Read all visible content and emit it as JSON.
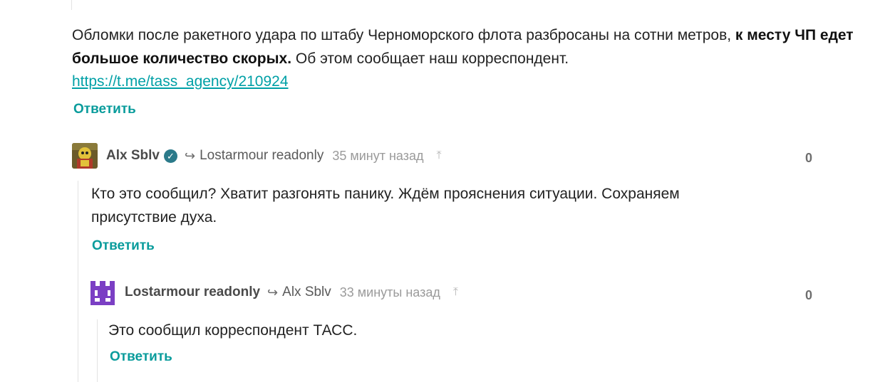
{
  "root_comment": {
    "text_before": "Обломки после ракетного удара по штабу Черноморского флота разбросаны на сотни метров, ",
    "text_bold": "к месту ЧП едет большое количество скорых.",
    "text_after": " Об этом сообщает наш корреспондент.",
    "link": "https://t.me/tass_agency/210924",
    "reply_label": "Ответить"
  },
  "comments": [
    {
      "author": "Alx Sblv",
      "verified": true,
      "reply_to": "Lostarmour readonly",
      "time": "35 минут назад",
      "score": "0",
      "text_line1": "Кто это сообщил? Хватит разгонять панику. Ждём прояснения ситуации. Сохраняем",
      "text_line2": "присутствие духа.",
      "reply_label": "Ответить"
    },
    {
      "author": "Lostarmour readonly",
      "verified": false,
      "reply_to": "Alx Sblv",
      "time": "33 минуты назад",
      "score": "0",
      "text": "Это сообщил корреспондент ТАСС.",
      "reply_label": "Ответить"
    }
  ],
  "icons": {
    "reply_arrow": "reply-arrow-icon",
    "up": "arrow-up-icon",
    "verified": "verified-check-icon"
  },
  "colors": {
    "link": "#00a0a6",
    "reply": "#0a9c9c",
    "verified": "#2b7a8a",
    "avatar2": "#7b3fc4"
  }
}
